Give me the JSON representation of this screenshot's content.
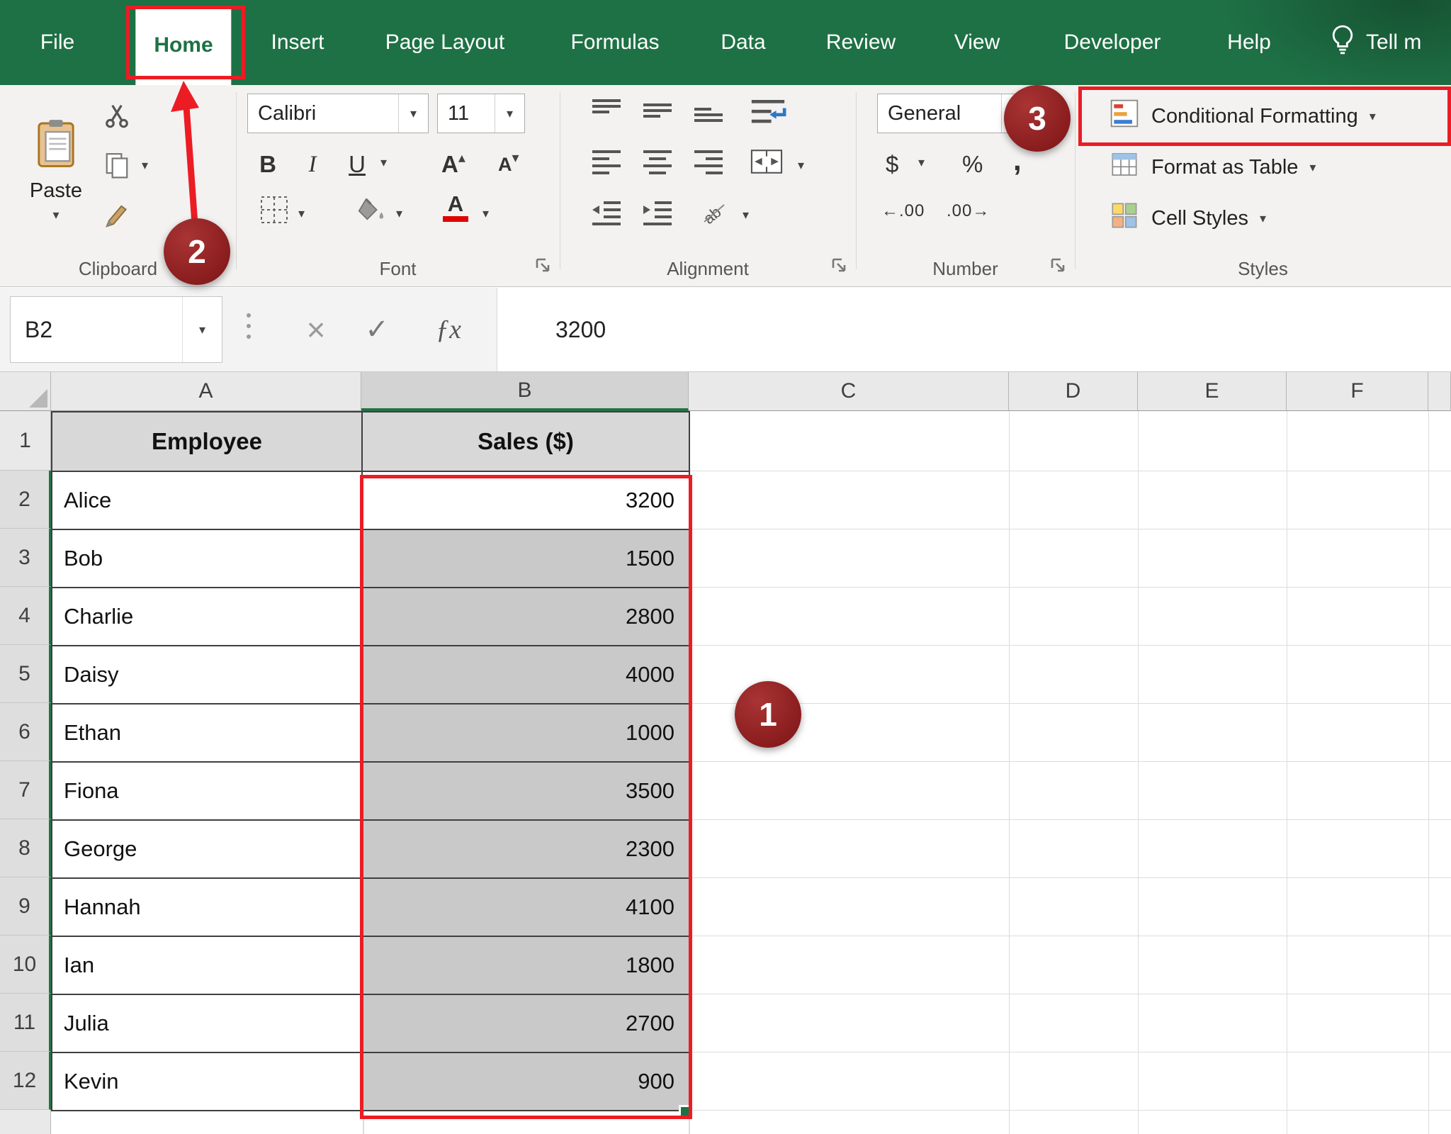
{
  "tabbar": {
    "tabs": [
      "File",
      "Home",
      "Insert",
      "Page Layout",
      "Formulas",
      "Data",
      "Review",
      "View",
      "Developer",
      "Help"
    ],
    "active_tab": "Home",
    "tell_me": "Tell m"
  },
  "ribbon": {
    "clipboard": {
      "label": "Clipboard",
      "paste": "Paste"
    },
    "font": {
      "label": "Font",
      "family": "Calibri",
      "size": "11",
      "bold": "B",
      "italic": "I",
      "underline": "U",
      "color_letter": "A",
      "grow_letter": "A",
      "shrink_letter": "A"
    },
    "alignment": {
      "label": "Alignment"
    },
    "number": {
      "label": "Number",
      "format": "General",
      "currency": "$",
      "percent": "%",
      "comma": ","
    },
    "styles": {
      "label": "Styles",
      "conditional_formatting": "Conditional Formatting",
      "format_as_table": "Format as Table",
      "cell_styles": "Cell Styles"
    }
  },
  "formula_bar": {
    "name_box": "B2",
    "value": "3200"
  },
  "sheet": {
    "col_headers": [
      "A",
      "B",
      "C",
      "D",
      "E",
      "F"
    ],
    "row_numbers": [
      "1",
      "2",
      "3",
      "4",
      "5",
      "6",
      "7",
      "8",
      "9",
      "10",
      "11",
      "12"
    ],
    "header_employee": "Employee",
    "header_sales": "Sales ($)",
    "rows": [
      {
        "name": "Alice",
        "sales": "3200"
      },
      {
        "name": "Bob",
        "sales": "1500"
      },
      {
        "name": "Charlie",
        "sales": "2800"
      },
      {
        "name": "Daisy",
        "sales": "4000"
      },
      {
        "name": "Ethan",
        "sales": "1000"
      },
      {
        "name": "Fiona",
        "sales": "3500"
      },
      {
        "name": "George",
        "sales": "2300"
      },
      {
        "name": "Hannah",
        "sales": "4100"
      },
      {
        "name": "Ian",
        "sales": "1800"
      },
      {
        "name": "Julia",
        "sales": "2700"
      },
      {
        "name": "Kevin",
        "sales": "900"
      }
    ]
  },
  "annotations": {
    "step_1": "1",
    "step_2": "2",
    "step_3": "3"
  },
  "icons": {
    "chevron": "▾",
    "triangle_up": "▴",
    "triangle_down": "▾",
    "cancel": "×",
    "enter": "✓",
    "fx": "ƒx",
    "increase_decimal": "←.00",
    "decrease_decimal": ".00→",
    "orientation_ab": "ab"
  },
  "colors": {
    "excel_green": "#1e7145",
    "header_green": "#217346",
    "annotation_red": "#ec1c24",
    "callout_maroon": "#8e1b1e",
    "selection_gray": "#c9c9c9"
  }
}
